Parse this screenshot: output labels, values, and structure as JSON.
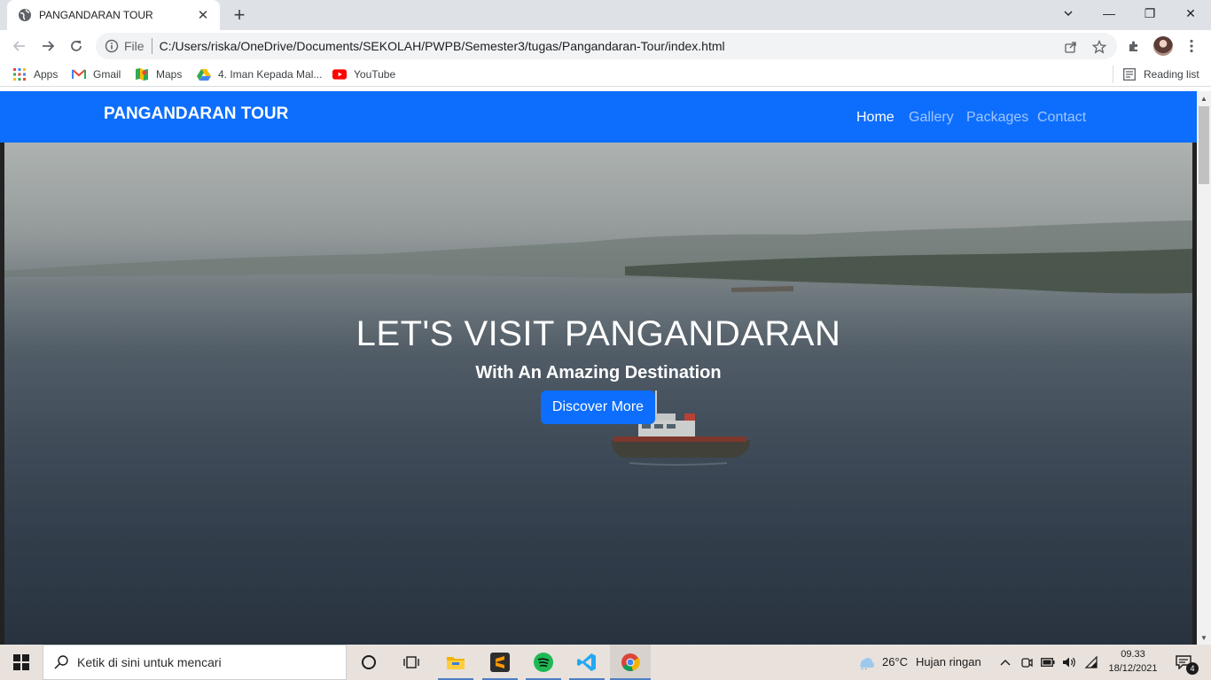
{
  "browser": {
    "tab": {
      "title": "PANGANDARAN TOUR",
      "favicon": "globe-icon",
      "close": "✕"
    },
    "new_tab": "+",
    "window_controls": {
      "minimize": "—",
      "maximize": "❐",
      "close": "✕"
    },
    "omnibox": {
      "scheme_label": "File",
      "url": "C:/Users/riska/OneDrive/Documents/SEKOLAH/PWPB/Semester3/tugas/Pangandaran-Tour/index.html"
    },
    "bookmarks": [
      {
        "label": "Apps",
        "icon": "apps-grid-icon"
      },
      {
        "label": "Gmail",
        "icon": "gmail-icon"
      },
      {
        "label": "Maps",
        "icon": "maps-icon"
      },
      {
        "label": "4. Iman Kepada Mal...",
        "icon": "drive-icon"
      },
      {
        "label": "YouTube",
        "icon": "youtube-icon"
      }
    ],
    "reading_list": "Reading list"
  },
  "site": {
    "brand": "PANGANDARAN TOUR",
    "nav": [
      {
        "label": "Home",
        "active": true
      },
      {
        "label": "Gallery",
        "active": false
      },
      {
        "label": "Packages",
        "active": false
      },
      {
        "label": "Contact",
        "active": false
      }
    ],
    "hero": {
      "title": "LET'S VISIT PANGANDARAN",
      "subtitle": "With An Amazing Destination",
      "button": "Discover More"
    },
    "colors": {
      "primary": "#0d6efd"
    }
  },
  "taskbar": {
    "search_placeholder": "Ketik di sini untuk mencari",
    "weather": {
      "temp": "26°C",
      "condition": "Hujan ringan"
    },
    "clock": {
      "time": "09.33",
      "date": "18/12/2021"
    },
    "notifications": "4",
    "apps": [
      "cortana-icon",
      "task-view-icon",
      "file-explorer-icon",
      "sublime-text-icon",
      "spotify-icon",
      "vscode-icon",
      "chrome-icon"
    ]
  }
}
